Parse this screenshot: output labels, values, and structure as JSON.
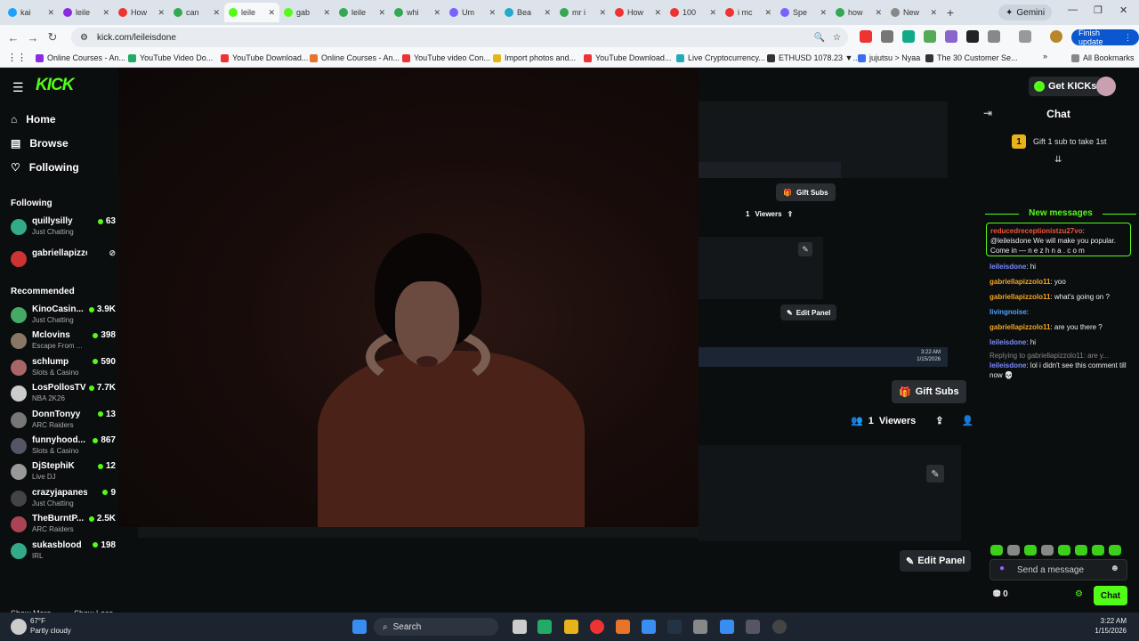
{
  "browser": {
    "tabs": [
      {
        "label": "kai",
        "color": "#1aa3ff"
      },
      {
        "label": "leile",
        "color": "#8a2be2"
      },
      {
        "label": "How",
        "color": "#e33"
      },
      {
        "label": "can",
        "color": "#34a853"
      },
      {
        "label": "leile",
        "color": "#53fc18"
      },
      {
        "label": "gab",
        "color": "#53fc18"
      },
      {
        "label": "leile",
        "color": "#34a853"
      },
      {
        "label": "whi",
        "color": "#34a853"
      },
      {
        "label": "Um",
        "color": "#7b61ff"
      },
      {
        "label": "Bea",
        "color": "#22aacc"
      },
      {
        "label": "mr i",
        "color": "#34a853"
      },
      {
        "label": "How",
        "color": "#e33"
      },
      {
        "label": "100",
        "color": "#e33"
      },
      {
        "label": "i mc",
        "color": "#e33"
      },
      {
        "label": "Spe",
        "color": "#7b61ff"
      },
      {
        "label": "how",
        "color": "#34a853"
      },
      {
        "label": "New",
        "color": "#888"
      }
    ],
    "gemini_label": "Gemini",
    "url": "kick.com/leileisdone",
    "finish_update": "Finish update",
    "bookmarks": [
      "Online Courses - An...",
      "YouTube Video Do...",
      "YouTube Download...",
      "Online Courses - An...",
      "YouTube video Con...",
      "Import photos and...",
      "YouTube Download...",
      "Live Cryptocurrency...",
      "ETHUSD 1078.23 ▼...",
      "jujutsu > Nyaa",
      "The 30 Customer Se..."
    ],
    "all_bookmarks": "All Bookmarks"
  },
  "kick": {
    "logo": "KICK",
    "get_kicks": "Get KICKs",
    "nav": [
      {
        "label": "Home",
        "icon": "home-icon"
      },
      {
        "label": "Browse",
        "icon": "browse-icon"
      },
      {
        "label": "Following",
        "icon": "heart-icon"
      }
    ],
    "following_title": "Following",
    "following": [
      {
        "name": "quillysilly",
        "category": "Just Chatting",
        "viewers": "63"
      },
      {
        "name": "gabriellapizzol...",
        "category": "",
        "viewers": ""
      }
    ],
    "recommended_title": "Recommended",
    "recommended": [
      {
        "name": "KinoCasin...",
        "category": "Just Chatting",
        "viewers": "3.9K"
      },
      {
        "name": "Mclovins",
        "category": "Escape From ...",
        "viewers": "398"
      },
      {
        "name": "schlump",
        "category": "Slots & Casino",
        "viewers": "590"
      },
      {
        "name": "LosPollosTV",
        "category": "NBA 2K26",
        "viewers": "7.7K"
      },
      {
        "name": "DonnTonyy",
        "category": "ARC Raiders",
        "viewers": "13"
      },
      {
        "name": "funnyhood...",
        "category": "Slots & Casino",
        "viewers": "867"
      },
      {
        "name": "DjStephiK",
        "category": "Live DJ",
        "viewers": "12"
      },
      {
        "name": "crazyjapanese",
        "category": "Just Chatting",
        "viewers": "9"
      },
      {
        "name": "TheBurntP...",
        "category": "ARC Raiders",
        "viewers": "2.5K"
      },
      {
        "name": "sukasblood",
        "category": "IRL",
        "viewers": "198"
      }
    ],
    "show_more": "Show More",
    "show_less": "Show Less",
    "gift_subs": "Gift Subs",
    "viewers_count": "1",
    "viewers_label": "Viewers",
    "edit_panel": "Edit Panel",
    "mini_time": "3:22 AM",
    "mini_date": "1/15/2026"
  },
  "chat": {
    "title": "Chat",
    "gift_badge": "1",
    "gift_text": "Gift 1 sub to take 1st",
    "new_messages": "New messages",
    "pinned_user": "reducedreceptionistzu27vo",
    "pinned_text": ": @leileisdone We will make you popular. Come in — n e z h n a . c o m",
    "messages": [
      {
        "user": "leileisdone",
        "text": ": hi"
      },
      {
        "user": "gabriellapizzolo11",
        "text": ": yoo"
      },
      {
        "user": "gabriellapizzolo11",
        "text": ": what's going on ?"
      },
      {
        "user": "livingnoise",
        "text": ":"
      },
      {
        "user": "gabriellapizzolo11",
        "text": ": are you there ?"
      },
      {
        "user": "leileisdone",
        "text": ": hi"
      },
      {
        "user": "",
        "text": "Replying to gabriellapizzolo11: are y..."
      },
      {
        "user": "leileisdone",
        "text": ": lol i didn't see this comment till now 💀"
      }
    ],
    "send_placeholder": "Send a message",
    "kicks_count": "0",
    "send_button": "Chat"
  },
  "taskbar": {
    "temp": "67°F",
    "weather": "Partly cloudy",
    "search": "Search",
    "time": "3:22 AM",
    "date": "1/15/2026"
  },
  "colors": {
    "accent": "#53fc18"
  }
}
